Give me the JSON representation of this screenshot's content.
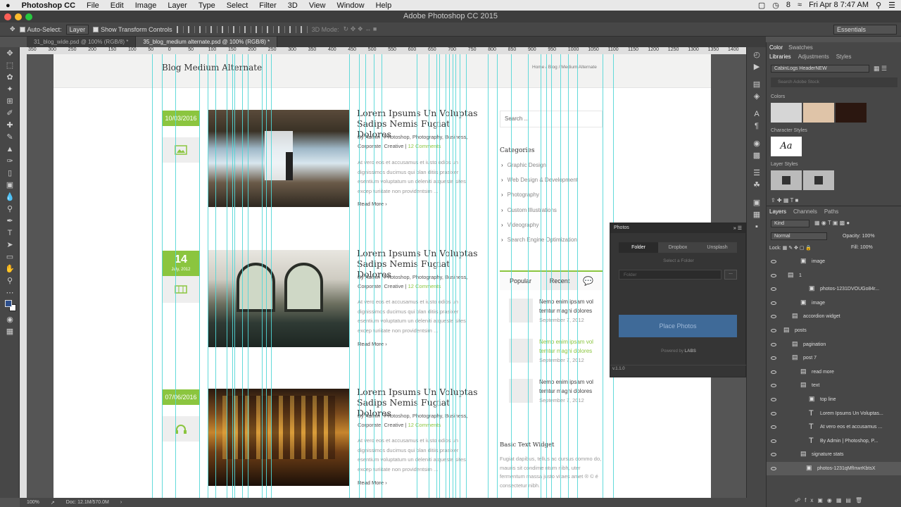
{
  "menubar": {
    "app": "Photoshop CC",
    "items": [
      "File",
      "Edit",
      "Image",
      "Layer",
      "Type",
      "Select",
      "Filter",
      "3D",
      "View",
      "Window",
      "Help"
    ],
    "badge": "8",
    "clock": "Fri Apr 8  7:47 AM"
  },
  "window": {
    "title": "Adobe Photoshop CC 2015"
  },
  "options": {
    "auto_select": "Auto-Select:",
    "auto_select_value": "Layer",
    "transform": "Show Transform Controls",
    "mode3d": "3D Mode:",
    "workspace": "Essentials"
  },
  "tabs": [
    {
      "label": "31_blog_wide.psd @ 100% (RGB/8) *"
    },
    {
      "label": "35_blog_medium alternate.psd @ 100% (RGB/8) *"
    }
  ],
  "ruler": [
    "350",
    "300",
    "250",
    "200",
    "150",
    "100",
    "50",
    "0",
    "50",
    "100",
    "150",
    "200",
    "250",
    "300",
    "350",
    "400",
    "450",
    "500",
    "550",
    "600",
    "650",
    "700",
    "750",
    "800",
    "850",
    "900",
    "950",
    "1000",
    "1050",
    "1100",
    "1150",
    "1200",
    "1250",
    "1300",
    "1350",
    "1400"
  ],
  "doc": {
    "page_title": "Blog Medium Alternate",
    "breadcrumb": {
      "home": "Home",
      "blog": "Blog",
      "current": "Medium Alternate",
      "sep": "/"
    },
    "posts": [
      {
        "date": "10/03/2016",
        "title": "Lorem Ipsums Un Voluptas Sadips Nemis Fugiat Dolores",
        "by": "By",
        "author": "Admin",
        "cats": "Photoshop, Photography, Business, Corporate, Creative",
        "comments": "12 Comments",
        "excerpt": "At vero eos et accusamus et iusto odios un dignissimos ducimus qui blan ditiis prasixer esentium voluptatum un deleniti atqueste sites excep turiitate non providentsim ...",
        "more": "Read More",
        "icon": "image-icon"
      },
      {
        "date_day": "14",
        "date_month": "July, 2012",
        "title": "Lorem Ipsums Un Voluptas Sadips Nemis Fugiat Dolores",
        "by": "By",
        "author": "Admin",
        "cats": "Photoshop, Photography, Business, Corporate, Creative",
        "comments": "12 Comments",
        "excerpt": "At vero eos et accusamus et iusto odios un dignissimos ducimus qui blan ditiis prasixer esentium voluptatum un deleniti atqueste sites excep turiitate non providentsim ...",
        "more": "Read More",
        "icon": "film-icon"
      },
      {
        "date": "07/06/2016",
        "title": "Lorem Ipsums Un Voluptas Sadips Nemis Fugiat Dolores",
        "by": "By",
        "author": "Admin",
        "cats": "Photoshop, Photography, Business, Corporate, Creative",
        "comments": "12 Comments",
        "excerpt": "At vero eos et accusamus et iusto odios un dignissimos ducimus qui blan ditiis prasixer esentium voluptatum un deleniti atqueste sites excep turiitate non providentsim ...",
        "more": "Read More",
        "icon": "headphones-icon"
      }
    ],
    "sidebar": {
      "search_placeholder": "Search ...",
      "categories_title": "Categories",
      "categories": [
        "Graphic Design",
        "Web Design & Development",
        "Photography",
        "Custom Illustrations",
        "Videography",
        "Search Engine Optimization"
      ],
      "tab_popular": "Popular",
      "tab_recent": "Recent",
      "recent": [
        {
          "text": "Nemo enim ipsam vol temtur magni dolores",
          "date": "September 7, 2012"
        },
        {
          "text": "Nemo enim ipsam vol temtur magni dolores",
          "date": "September 7, 2012"
        },
        {
          "text": "Nemo enim ipsam vol temtur magni dolores",
          "date": "September 7, 2012"
        }
      ],
      "widget_title": "Basic Text Widget",
      "widget_text": "Fugiat dapibus, tellus ac cursus commo do, mauris sit condime ntum nibh, uter fermentum massa justo vitaes amet ® © é consectetur nibh."
    }
  },
  "right": {
    "tab_color": "Color",
    "tab_swatches": "Swatches",
    "tab_libraries": "Libraries",
    "tab_adjustments": "Adjustments",
    "tab_styles": "Styles",
    "library": "CabinLogs HeaderNEW",
    "search_placeholder": "Search Adobe Stock",
    "colors_label": "Colors",
    "char_label": "Character Styles",
    "char_sample": "Aa",
    "layer_styles_label": "Layer Styles",
    "swatch_colors": [
      "#d6d6d6",
      "#dfc4a8",
      "#2b1710"
    ],
    "tab_layers": "Layers",
    "tab_channels": "Channels",
    "tab_paths": "Paths",
    "kind": "Kind",
    "blend": "Normal",
    "opacity_label": "Opacity:",
    "opacity": "100%",
    "lock_label": "Lock:",
    "fill_label": "Fill:",
    "fill": "100%",
    "layers": [
      {
        "name": "image",
        "type": "smart"
      },
      {
        "name": "1",
        "type": "folder"
      },
      {
        "name": "photos-1231DVOUGo84r...",
        "type": "smart"
      },
      {
        "name": "image",
        "type": "smart"
      },
      {
        "name": "accordion widget",
        "type": "folder"
      },
      {
        "name": "posts",
        "type": "folder"
      },
      {
        "name": "pagination",
        "type": "folder"
      },
      {
        "name": "post 7",
        "type": "folder"
      },
      {
        "name": "read more",
        "type": "folder"
      },
      {
        "name": "text",
        "type": "folder"
      },
      {
        "name": "top line",
        "type": "smart"
      },
      {
        "name": "Lorem Ipsums Un Voluptas...",
        "type": "text"
      },
      {
        "name": "At vero eos et accusamus ...",
        "type": "text"
      },
      {
        "name": "By Admin  |  Photoshop, P...",
        "type": "text"
      },
      {
        "name": "signature stats",
        "type": "folder"
      },
      {
        "name": "photos-1231qMfInwrKbtsX",
        "type": "smart"
      }
    ]
  },
  "photos_panel": {
    "title": "Photos",
    "tabs": [
      "Folder",
      "Dropbox",
      "Unsplash"
    ],
    "select_label": "Select a Folder",
    "folder_placeholder": "Folder",
    "browse": "...",
    "place": "Place Photos",
    "powered": "Powered by",
    "brand": "LABS",
    "version": "v.1.1.0"
  },
  "status": {
    "zoom": "100%",
    "doc": "Doc: 12.1M/570.0M"
  }
}
